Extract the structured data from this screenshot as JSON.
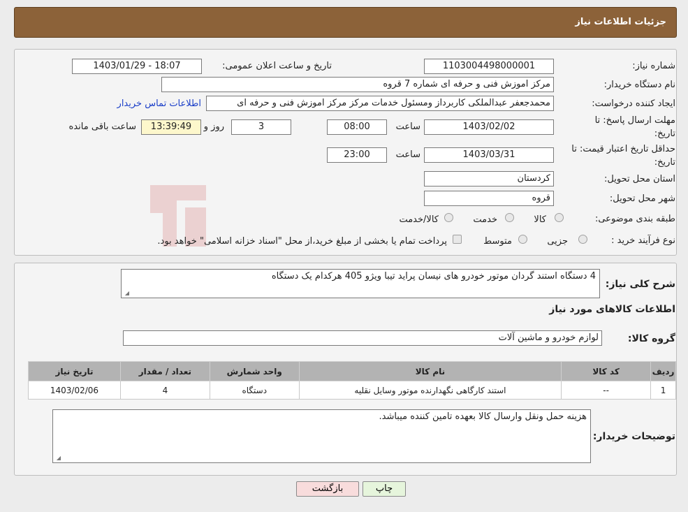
{
  "header": {
    "title": "جزئیات اطلاعات نیاز"
  },
  "form": {
    "need_number_label": "شماره نیاز:",
    "need_number": "1103004498000001",
    "announce_label": "تاریخ و ساعت اعلان عمومی:",
    "announce_value": "1403/01/29 - 18:07",
    "buyer_org_label": "نام دستگاه خریدار:",
    "buyer_org": "مرکز اموزش فنی و حرفه ای شماره 7 قروه",
    "creator_label": "ایجاد کننده درخواست:",
    "creator": "محمدجعفر  عبدالملکی  کاربرداز ومسئول خدمات مرکز مرکز اموزش فنی و حرفه ای",
    "contact_link": "اطلاعات تماس خریدار",
    "deadline_label_1": "مهلت ارسال پاسخ: تا",
    "deadline_label_2": "تاریخ:",
    "deadline_date": "1403/02/02",
    "time_label": "ساعت",
    "deadline_time": "08:00",
    "days_value": "3",
    "days_label": "روز و",
    "remaining_time": "13:39:49",
    "remaining_label": "ساعت باقی مانده",
    "validity_label_1": "حداقل تاریخ اعتبار قیمت: تا",
    "validity_label_2": "تاریخ:",
    "validity_date": "1403/03/31",
    "validity_time": "23:00",
    "province_label": "استان محل تحویل:",
    "province": "کردستان",
    "city_label": "شهر محل تحویل:",
    "city": "قروه",
    "category_label": "طبقه بندی موضوعی:",
    "category_options": [
      "کالا",
      "خدمت",
      "کالا/خدمت"
    ],
    "process_label": "نوع فرآیند خرید :",
    "process_options": [
      "جزیی",
      "متوسط"
    ],
    "payment_note": "پرداخت تمام یا بخشی از مبلغ خرید،از محل \"اسناد خزانه اسلامی\" خواهد بود."
  },
  "details": {
    "summary_label": "شرح کلی نیاز:",
    "summary": "4 دستگاه استند گردان موتور خودرو های نیسان پراید تیبا ویژو 405 هرکدام یک دستگاه",
    "goods_title": "اطلاعات کالاهای مورد نیاز",
    "group_label": "گروه کالا:",
    "group": "لوازم خودرو و ماشین آلات",
    "table": {
      "headers": [
        "ردیف",
        "کد کالا",
        "نام کالا",
        "واحد شمارش",
        "تعداد / مقدار",
        "تاریخ نیاز"
      ],
      "rows": [
        [
          "1",
          "--",
          "استند کارگاهی نگهدارنده موتور وسایل نقلیه",
          "دستگاه",
          "4",
          "1403/02/06"
        ]
      ]
    },
    "buyer_notes_label": "توضیحات خریدار:",
    "buyer_notes": "هزینه حمل ونقل وارسال کالا بعهده تامین کننده میباشد."
  },
  "buttons": {
    "print": "چاپ",
    "back": "بازگشت"
  },
  "colors": {
    "header": "#8c6239",
    "link": "#1a3ec8",
    "back_button": "#f8dcdc",
    "print_button": "#e6f5dc"
  }
}
